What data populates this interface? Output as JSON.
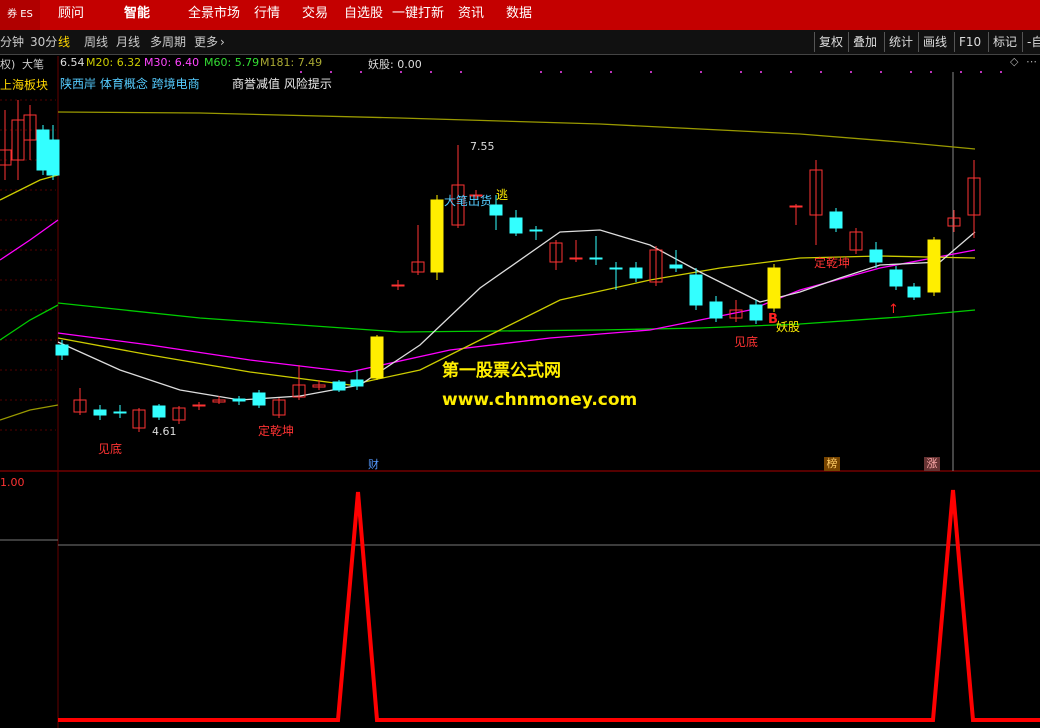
{
  "app": {
    "logo_text": "券 ES",
    "nav": [
      {
        "label": "顾问"
      },
      {
        "label": "智能"
      },
      {
        "label": "全景市场"
      },
      {
        "label": "行情"
      },
      {
        "label": "交易"
      },
      {
        "label": "自选股"
      },
      {
        "label": "一键打新"
      },
      {
        "label": "资讯"
      },
      {
        "label": "数据"
      }
    ]
  },
  "toolbar": {
    "periods": [
      "分钟",
      "30分",
      "线",
      "周线",
      "月线",
      "多周期",
      "更多"
    ],
    "buttons": [
      "复权",
      "叠加",
      "统计",
      "画线",
      "F10",
      "标记",
      "-自"
    ]
  },
  "infobar": {
    "fq": "权)",
    "indicator_name": "大笔",
    "ma_values": [
      {
        "text": "6.54"
      },
      {
        "text": "M20: 6.32"
      },
      {
        "text": "M30: 6.40"
      },
      {
        "text": "M60: 5.79"
      },
      {
        "text": "M181: 7.49"
      }
    ],
    "yaogu": "妖股: 0.00",
    "concepts": "陕西岸 体育概念 跨境电商",
    "shanghai": "上海板块",
    "risk": "商誉减值 风险提示"
  },
  "annotations": {
    "high": "7.55",
    "low": "4.61",
    "jiandi1": "见底",
    "jiandi2": "见底",
    "dingqiankun1": "定乾坤",
    "dingqiankun2": "定乾坤",
    "dabichuhuo": "大笔出货",
    "tao": "逃",
    "yaogu_tag": "妖股",
    "b_tag": "B",
    "cai": "财",
    "bang": "榜",
    "zhang": "涨"
  },
  "watermark": {
    "line1": "第一股票公式网",
    "line2": "www.chnmoney.com"
  },
  "lower": {
    "scale_top": "1.00"
  },
  "colors": {
    "bg": "#000000",
    "up": "#ff3333",
    "down": "#33ffff",
    "signal": "#ffee00",
    "ma_white": "#dddddd",
    "ma_yellow": "#cccc00",
    "ma_magenta": "#ff00ff",
    "ma_green": "#00cc00",
    "ma_olive": "#999900",
    "lower_line": "#ff0000"
  }
}
